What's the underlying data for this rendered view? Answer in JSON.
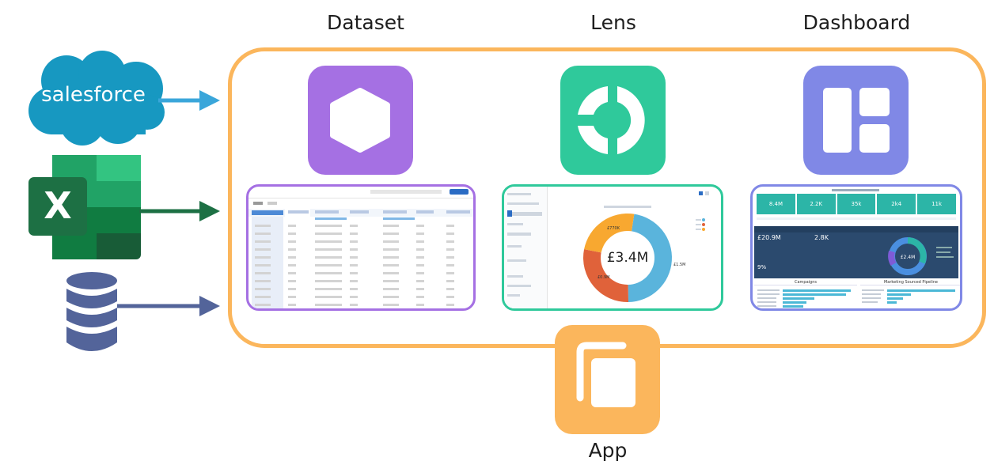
{
  "labels": {
    "dataset": "Dataset",
    "lens": "Lens",
    "dashboard": "Dashboard",
    "app": "App"
  },
  "sources": {
    "salesforce": "salesforce",
    "excel": "X"
  },
  "lens_preview": {
    "center_value": "£3.4M",
    "segments": [
      {
        "label": "£1.5M",
        "color": "#5ab4dc",
        "value": 1.5
      },
      {
        "label": "£0.9M",
        "color": "#e0623a",
        "value": 0.9
      },
      {
        "label": "£770K",
        "color": "#f8a830",
        "value": 0.77
      }
    ]
  },
  "dashboard_preview": {
    "kpis": [
      "8.4M",
      "2.2K",
      "35k",
      "2k4",
      "11k"
    ],
    "metric_big": "£20.9M",
    "metric_count": "2.8K",
    "metric_pct": "9%",
    "donut_value": "£2.4M",
    "panel_left": "Campaigns",
    "panel_right": "Marketing Sourced Pipeline"
  },
  "colors": {
    "container_border": "#fbb65c",
    "dataset": "#a570e3",
    "lens": "#2fc99b",
    "dashboard": "#8088e6",
    "app": "#fbb65c",
    "salesforce": "#1798c1",
    "excel": "#1d7044",
    "database": "#53649a"
  }
}
